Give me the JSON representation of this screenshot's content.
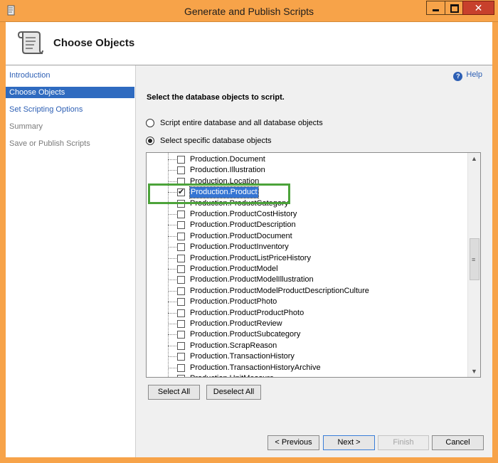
{
  "window": {
    "title": "Generate and Publish Scripts"
  },
  "header": {
    "title": "Choose Objects"
  },
  "sidebar": {
    "items": [
      {
        "label": "Introduction",
        "state": "link"
      },
      {
        "label": "Choose Objects",
        "state": "selected"
      },
      {
        "label": "Set Scripting Options",
        "state": "link"
      },
      {
        "label": "Summary",
        "state": "disabled"
      },
      {
        "label": "Save or Publish Scripts",
        "state": "disabled"
      }
    ]
  },
  "main": {
    "help": "Help",
    "instruction": "Select the database objects to script.",
    "radio_entire": "Script entire database and all database objects",
    "radio_specific": "Select specific database objects",
    "selected_option": "specific"
  },
  "tree": {
    "items": [
      {
        "label": "Production.Document",
        "checked": false,
        "selected": false
      },
      {
        "label": "Production.Illustration",
        "checked": false,
        "selected": false
      },
      {
        "label": "Production.Location",
        "checked": false,
        "selected": false
      },
      {
        "label": "Production.Product",
        "checked": true,
        "selected": true
      },
      {
        "label": "Production.ProductCategory",
        "checked": false,
        "selected": false
      },
      {
        "label": "Production.ProductCostHistory",
        "checked": false,
        "selected": false
      },
      {
        "label": "Production.ProductDescription",
        "checked": false,
        "selected": false
      },
      {
        "label": "Production.ProductDocument",
        "checked": false,
        "selected": false
      },
      {
        "label": "Production.ProductInventory",
        "checked": false,
        "selected": false
      },
      {
        "label": "Production.ProductListPriceHistory",
        "checked": false,
        "selected": false
      },
      {
        "label": "Production.ProductModel",
        "checked": false,
        "selected": false
      },
      {
        "label": "Production.ProductModelIllustration",
        "checked": false,
        "selected": false
      },
      {
        "label": "Production.ProductModelProductDescriptionCulture",
        "checked": false,
        "selected": false
      },
      {
        "label": "Production.ProductPhoto",
        "checked": false,
        "selected": false
      },
      {
        "label": "Production.ProductProductPhoto",
        "checked": false,
        "selected": false
      },
      {
        "label": "Production.ProductReview",
        "checked": false,
        "selected": false
      },
      {
        "label": "Production.ProductSubcategory",
        "checked": false,
        "selected": false
      },
      {
        "label": "Production.ScrapReason",
        "checked": false,
        "selected": false
      },
      {
        "label": "Production.TransactionHistory",
        "checked": false,
        "selected": false
      },
      {
        "label": "Production.TransactionHistoryArchive",
        "checked": false,
        "selected": false
      },
      {
        "label": "Production.UnitMeasure",
        "checked": false,
        "selected": false
      }
    ]
  },
  "buttons": {
    "select_all": "Select All",
    "deselect_all": "Deselect All",
    "previous": "< Previous",
    "next": "Next >",
    "finish": "Finish",
    "cancel": "Cancel"
  },
  "colors": {
    "titlebar": "#f7a349",
    "selection": "#2f6bc0",
    "link": "#2d5fb4",
    "highlight_box": "#4ca33a"
  }
}
